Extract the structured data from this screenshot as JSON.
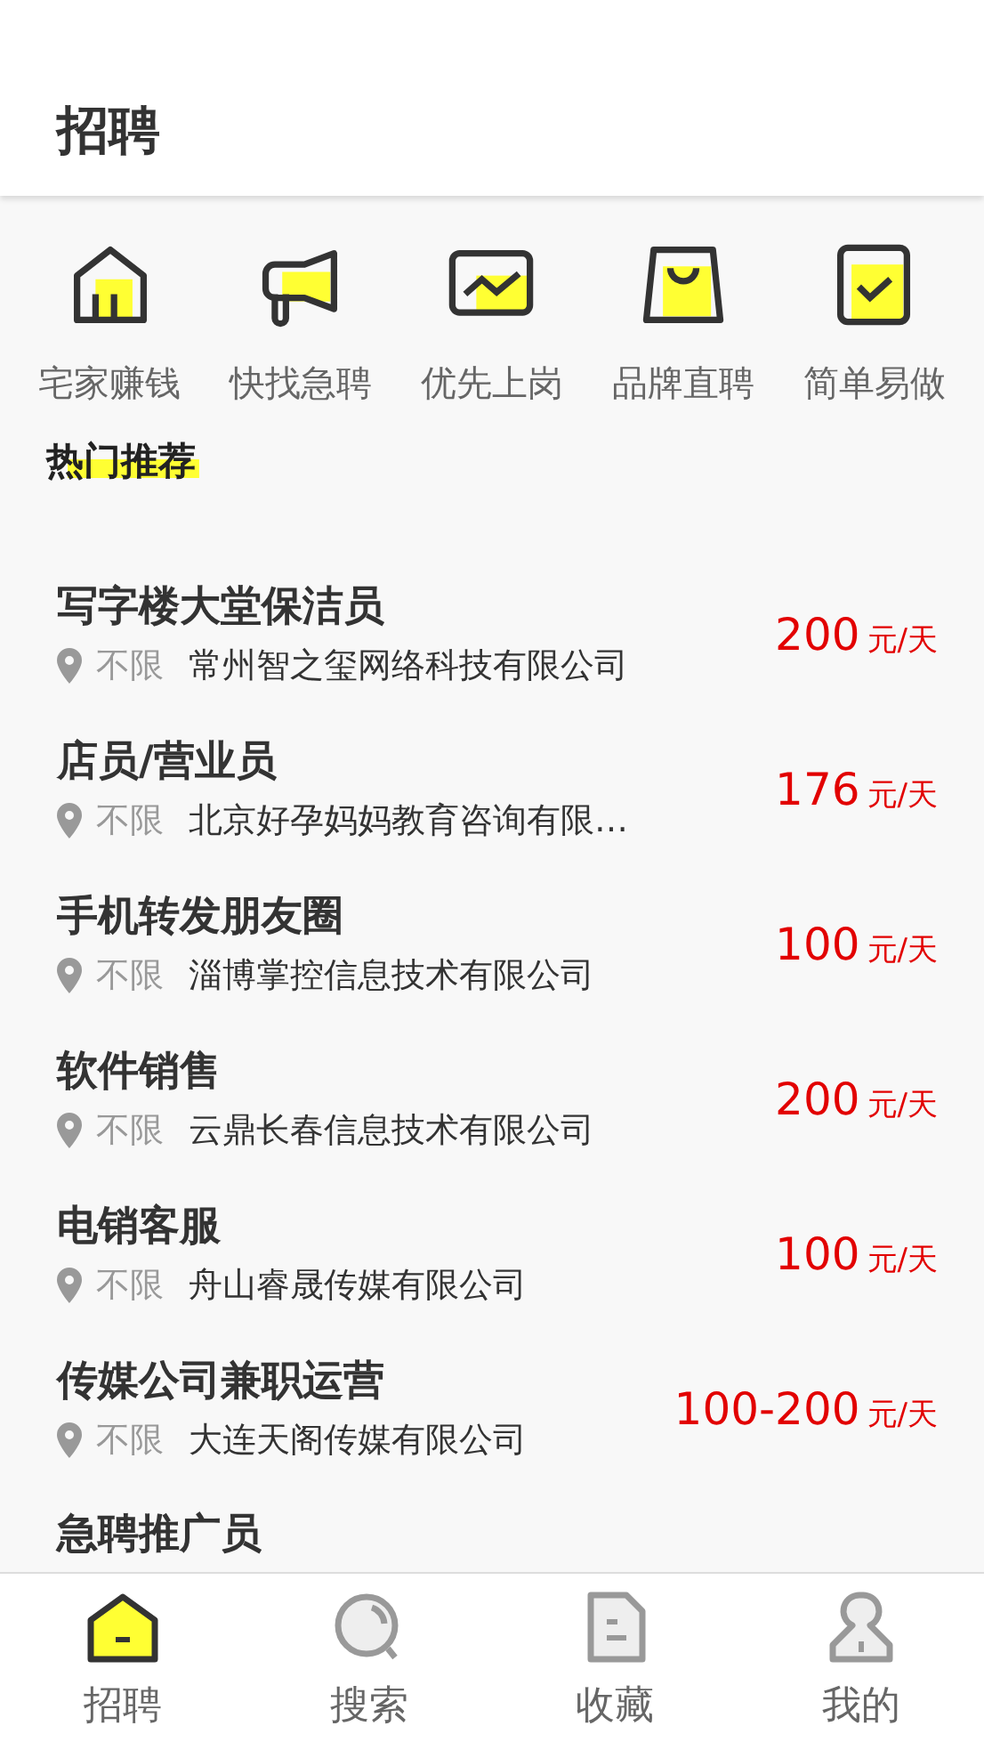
{
  "header": {
    "title": "招聘"
  },
  "categories": [
    {
      "kind": "home",
      "label": "宅家赚钱"
    },
    {
      "kind": "megaphone",
      "label": "快找急聘"
    },
    {
      "kind": "chart",
      "label": "优先上岗"
    },
    {
      "kind": "bag",
      "label": "品牌直聘"
    },
    {
      "kind": "check",
      "label": "简单易做"
    }
  ],
  "section_title": "热门推荐",
  "jobs": [
    {
      "title": "写字楼大堂保洁员",
      "location": "不限",
      "company": "常州智之玺网络科技有限公司",
      "salary": "200",
      "unit": "元/天"
    },
    {
      "title": "店员/营业员",
      "location": "不限",
      "company": "北京好孕妈妈教育咨询有限…",
      "salary": "176",
      "unit": "元/天"
    },
    {
      "title": "手机转发朋友圈",
      "location": "不限",
      "company": "淄博掌控信息技术有限公司",
      "salary": "100",
      "unit": "元/天"
    },
    {
      "title": "软件销售",
      "location": "不限",
      "company": "云鼎长春信息技术有限公司",
      "salary": "200",
      "unit": "元/天"
    },
    {
      "title": "电销客服",
      "location": "不限",
      "company": "舟山睿晟传媒有限公司",
      "salary": "100",
      "unit": "元/天"
    },
    {
      "title": "传媒公司兼职运营",
      "location": "不限",
      "company": "大连天阁传媒有限公司",
      "salary": "100-200",
      "unit": "元/天"
    },
    {
      "title": "急聘推广员"
    }
  ],
  "tabs": [
    {
      "kind": "home",
      "label": "招聘",
      "selected": true
    },
    {
      "kind": "search",
      "label": "搜索",
      "selected": false
    },
    {
      "kind": "doc",
      "label": "收藏",
      "selected": false
    },
    {
      "kind": "user",
      "label": "我的",
      "selected": false
    }
  ]
}
